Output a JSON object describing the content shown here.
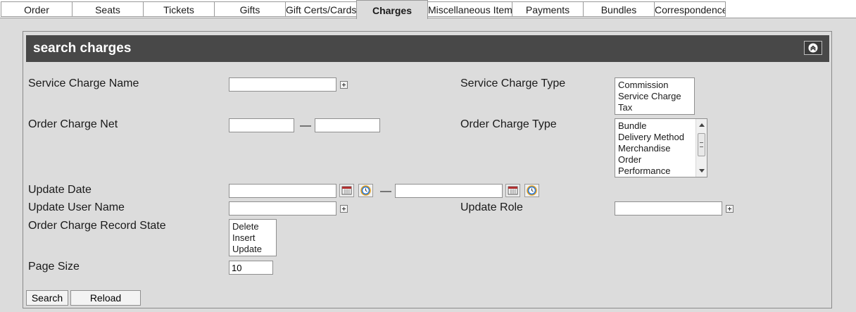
{
  "tabs": [
    {
      "label": "Order",
      "active": false
    },
    {
      "label": "Seats",
      "active": false
    },
    {
      "label": "Tickets",
      "active": false
    },
    {
      "label": "Gifts",
      "active": false
    },
    {
      "label": "Gift Certs/Cards",
      "active": false
    },
    {
      "label": "Charges",
      "active": true
    },
    {
      "label": "Miscellaneous Items",
      "active": false
    },
    {
      "label": "Payments",
      "active": false
    },
    {
      "label": "Bundles",
      "active": false
    },
    {
      "label": "Correspondence",
      "active": false
    }
  ],
  "panel": {
    "title": "search charges",
    "collapse_icon": "chevron-up-circle-icon"
  },
  "fields": {
    "service_charge_name": {
      "label": "Service Charge Name",
      "value": ""
    },
    "service_charge_type": {
      "label": "Service Charge Type",
      "options": [
        "Commission",
        "Service Charge",
        "Tax"
      ]
    },
    "order_charge_net": {
      "label": "Order Charge Net",
      "from": "",
      "to": "",
      "separator": "—"
    },
    "order_charge_type": {
      "label": "Order Charge Type",
      "options": [
        "Bundle",
        "Delivery Method",
        "Merchandise",
        "Order",
        "Performance"
      ]
    },
    "update_date": {
      "label": "Update Date",
      "from": "",
      "to": "",
      "separator": "—"
    },
    "update_user_name": {
      "label": "Update User Name",
      "value": ""
    },
    "update_role": {
      "label": "Update Role",
      "value": ""
    },
    "order_charge_record_state": {
      "label": "Order Charge Record State",
      "options": [
        "Delete",
        "Insert",
        "Update"
      ]
    },
    "page_size": {
      "label": "Page Size",
      "value": "10"
    }
  },
  "buttons": {
    "search": "Search",
    "reload": "Reload"
  },
  "colors": {
    "header_bg": "#484848",
    "page_bg": "#dcdcdc",
    "accent_blue": "#1e6fd0"
  }
}
